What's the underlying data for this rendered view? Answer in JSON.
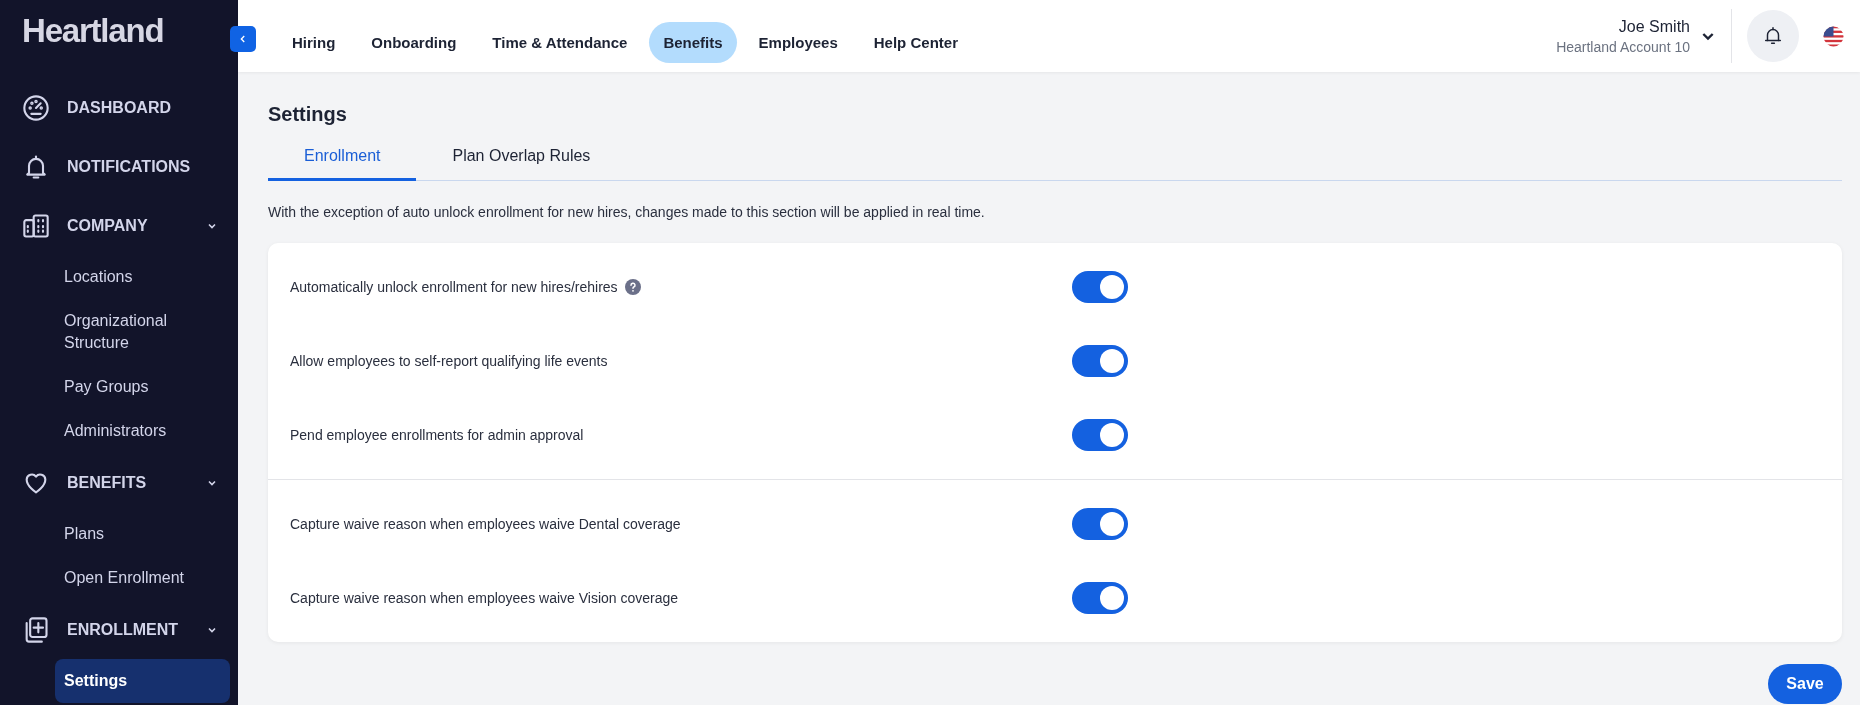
{
  "sidebar": {
    "logo": "Heartland",
    "items": [
      {
        "kind": "link",
        "label": "DASHBOARD"
      },
      {
        "kind": "link",
        "label": "NOTIFICATIONS"
      },
      {
        "kind": "group",
        "label": "COMPANY",
        "expanded": true,
        "children": [
          {
            "label": "Locations",
            "selected": false
          },
          {
            "label": "Organizational Structure",
            "selected": false
          },
          {
            "label": "Pay Groups",
            "selected": false
          },
          {
            "label": "Administrators",
            "selected": false
          }
        ]
      },
      {
        "kind": "group",
        "label": "BENEFITS",
        "expanded": true,
        "children": [
          {
            "label": "Plans",
            "selected": false
          },
          {
            "label": "Open Enrollment",
            "selected": false
          }
        ]
      },
      {
        "kind": "group",
        "label": "ENROLLMENT",
        "expanded": true,
        "children": [
          {
            "label": "Settings",
            "selected": true
          }
        ]
      }
    ]
  },
  "top_nav": [
    {
      "label": "Hiring",
      "selected": false
    },
    {
      "label": "Onboarding",
      "selected": false
    },
    {
      "label": "Time & Attendance",
      "selected": false
    },
    {
      "label": "Benefits",
      "selected": true
    },
    {
      "label": "Employees",
      "selected": false
    },
    {
      "label": "Help Center",
      "selected": false
    }
  ],
  "user": {
    "name": "Joe Smith",
    "account": "Heartland Account 10"
  },
  "page": {
    "title": "Settings",
    "tabs": [
      {
        "label": "Enrollment",
        "selected": true
      },
      {
        "label": "Plan Overlap Rules",
        "selected": false
      }
    ],
    "description": "With the exception of auto unlock enrollment for new hires, changes made to this section will be applied in real time.",
    "sections": [
      [
        {
          "label": "Automatically unlock enrollment for new hires/rehires",
          "help": true,
          "on": true
        },
        {
          "label": "Allow employees to self-report qualifying life events",
          "help": false,
          "on": true
        },
        {
          "label": "Pend employee enrollments for admin approval",
          "help": false,
          "on": true
        }
      ],
      [
        {
          "label": "Capture waive reason when employees waive Dental coverage",
          "help": false,
          "on": true
        },
        {
          "label": "Capture waive reason when employees waive Vision coverage",
          "help": false,
          "on": true
        }
      ]
    ],
    "save": "Save"
  }
}
